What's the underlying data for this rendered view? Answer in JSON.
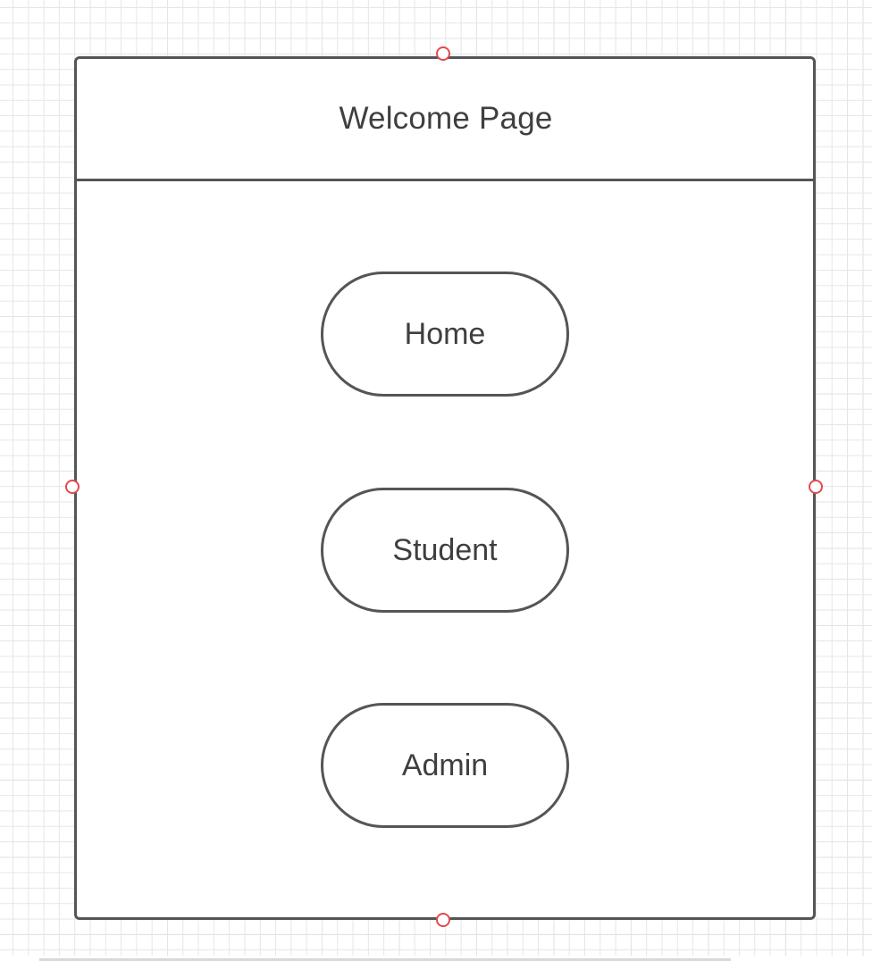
{
  "diagram": {
    "title": "Welcome Page",
    "buttons": [
      {
        "label": "Home"
      },
      {
        "label": "Student"
      },
      {
        "label": "Admin"
      }
    ]
  },
  "colors": {
    "stroke": "#555555",
    "text": "#3f3f3f",
    "handle": "#e04a50",
    "grid": "#e6e6e6"
  }
}
